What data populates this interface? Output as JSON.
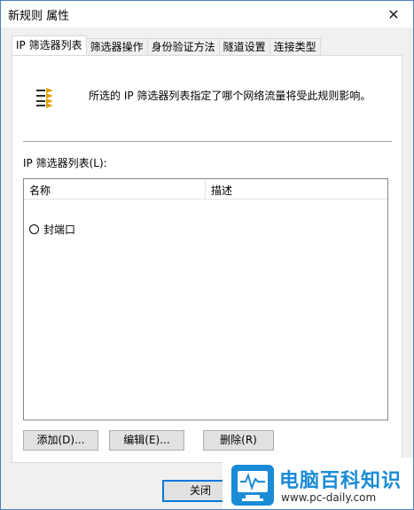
{
  "window": {
    "title": "新规则 属性",
    "close_symbol": "✕"
  },
  "tabs": [
    {
      "label": "IP 筛选器列表"
    },
    {
      "label": "筛选器操作"
    },
    {
      "label": "身份验证方法"
    },
    {
      "label": "隧道设置"
    },
    {
      "label": "连接类型"
    }
  ],
  "panel": {
    "icon": "filter-list-icon",
    "description": "所选的 IP 筛选器列表指定了哪个网络流量将受此规则影响。",
    "list_label": "IP 筛选器列表(L):",
    "columns": {
      "name": "名称",
      "description": "描述"
    },
    "rows": [
      {
        "name": "封端口",
        "selected": false
      }
    ]
  },
  "buttons": {
    "add": "添加(D)...",
    "edit": "编辑(E)...",
    "delete": "删除(R)",
    "close": "关闭"
  },
  "watermark": {
    "title": "电脑百科知识",
    "url": "www.pc-daily.com",
    "brand_color": "#1a8bd6"
  }
}
